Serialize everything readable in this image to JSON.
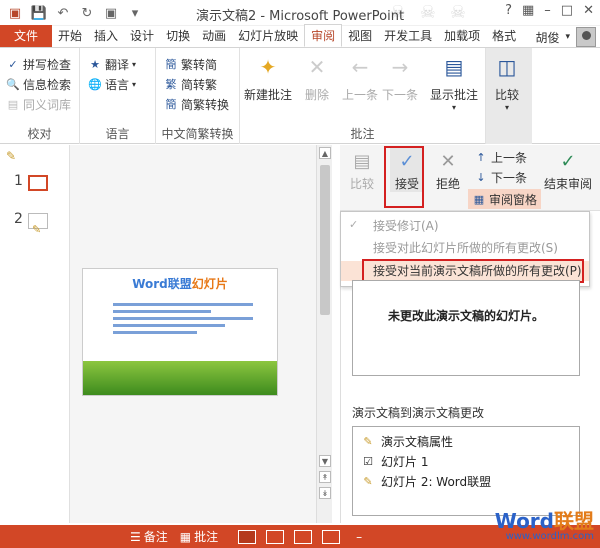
{
  "window": {
    "title": "演示文稿2 - Microsoft PowerPoint"
  },
  "tabs": [
    "文件",
    "开始",
    "插入",
    "设计",
    "切换",
    "动画",
    "幻灯片放映",
    "审阅",
    "视图",
    "开发工具",
    "加载项",
    "格式"
  ],
  "active_tab": "审阅",
  "user": {
    "name": "胡俊"
  },
  "ribbon": {
    "proofing": {
      "label": "校对",
      "items": [
        "拼写检查",
        "信息检索",
        "同义词库"
      ]
    },
    "language": {
      "label": "语言",
      "items": [
        "翻译",
        "语言"
      ]
    },
    "chinese": {
      "label": "中文简繁转换",
      "items": [
        "繁转简",
        "简转繁",
        "简繁转换"
      ]
    },
    "comments": {
      "label": "批注",
      "items": [
        "新建批注",
        "删除",
        "上一条",
        "下一条",
        "显示批注"
      ]
    },
    "compare": {
      "label": "比较"
    }
  },
  "thumbnails": {
    "numbers": [
      "1",
      "2"
    ]
  },
  "slide": {
    "title_main": "Word联盟",
    "title_accent": "幻灯片"
  },
  "revisions": {
    "toolbar": {
      "compare": "比较",
      "accept": "接受",
      "reject": "拒绝",
      "prev": "上一条",
      "next": "下一条",
      "pane": "审阅窗格",
      "end": "结束审阅"
    },
    "menu": [
      "接受修订(A)",
      "接受对此幻灯片所做的所有更改(S)",
      "接受对当前演示文稿所做的所有更改(P)"
    ],
    "info": "未更改此演示文稿的幻灯片。",
    "changes_heading": "演示文稿到演示文稿更改",
    "changes": [
      "演示文稿属性",
      "幻灯片 1",
      "幻灯片 2: Word联盟"
    ]
  },
  "statusbar": {
    "notes": "备注",
    "comments": "批注"
  },
  "watermark": {
    "main": "Word",
    "accent": "联盟",
    "url": "www.wordlm.com"
  }
}
